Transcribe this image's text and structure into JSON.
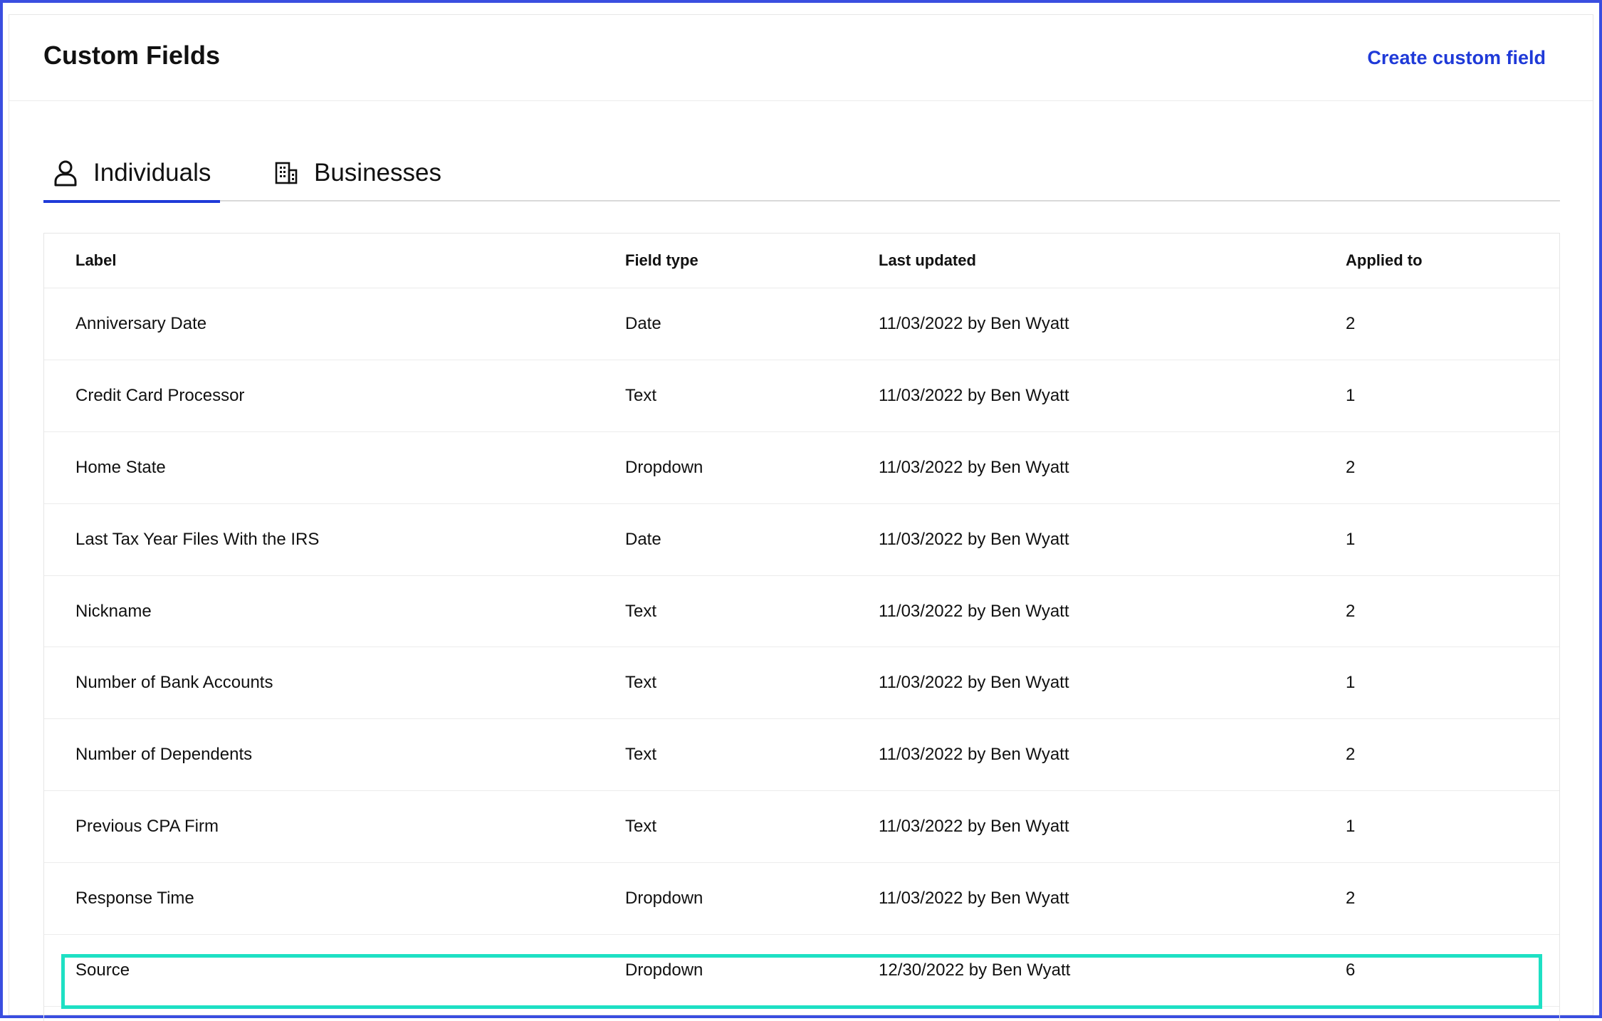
{
  "header": {
    "title": "Custom Fields",
    "create_label": "Create custom field"
  },
  "tabs": [
    {
      "label": "Individuals",
      "icon": "user-icon",
      "active": true
    },
    {
      "label": "Businesses",
      "icon": "building-icon",
      "active": false
    }
  ],
  "table": {
    "columns": [
      "Label",
      "Field type",
      "Last updated",
      "Applied to"
    ],
    "rows": [
      {
        "label": "Anniversary Date",
        "type": "Date",
        "updated": "11/03/2022 by Ben Wyatt",
        "applied": "2"
      },
      {
        "label": "Credit Card Processor",
        "type": "Text",
        "updated": "11/03/2022 by Ben Wyatt",
        "applied": "1"
      },
      {
        "label": "Home State",
        "type": "Dropdown",
        "updated": "11/03/2022 by Ben Wyatt",
        "applied": "2"
      },
      {
        "label": "Last Tax Year Files With the IRS",
        "type": "Date",
        "updated": "11/03/2022 by Ben Wyatt",
        "applied": "1"
      },
      {
        "label": "Nickname",
        "type": "Text",
        "updated": "11/03/2022 by Ben Wyatt",
        "applied": "2"
      },
      {
        "label": "Number of Bank Accounts",
        "type": "Text",
        "updated": "11/03/2022 by Ben Wyatt",
        "applied": "1"
      },
      {
        "label": "Number of Dependents",
        "type": "Text",
        "updated": "11/03/2022 by Ben Wyatt",
        "applied": "2"
      },
      {
        "label": "Previous CPA Firm",
        "type": "Text",
        "updated": "11/03/2022 by Ben Wyatt",
        "applied": "1"
      },
      {
        "label": "Response Time",
        "type": "Dropdown",
        "updated": "11/03/2022 by Ben Wyatt",
        "applied": "2"
      },
      {
        "label": "Source",
        "type": "Dropdown",
        "updated": "12/30/2022 by Ben Wyatt",
        "applied": "6"
      }
    ]
  },
  "colors": {
    "accent": "#1f3ad8",
    "frame_border": "#3a4ee0",
    "highlight": "#1ee0c4"
  }
}
